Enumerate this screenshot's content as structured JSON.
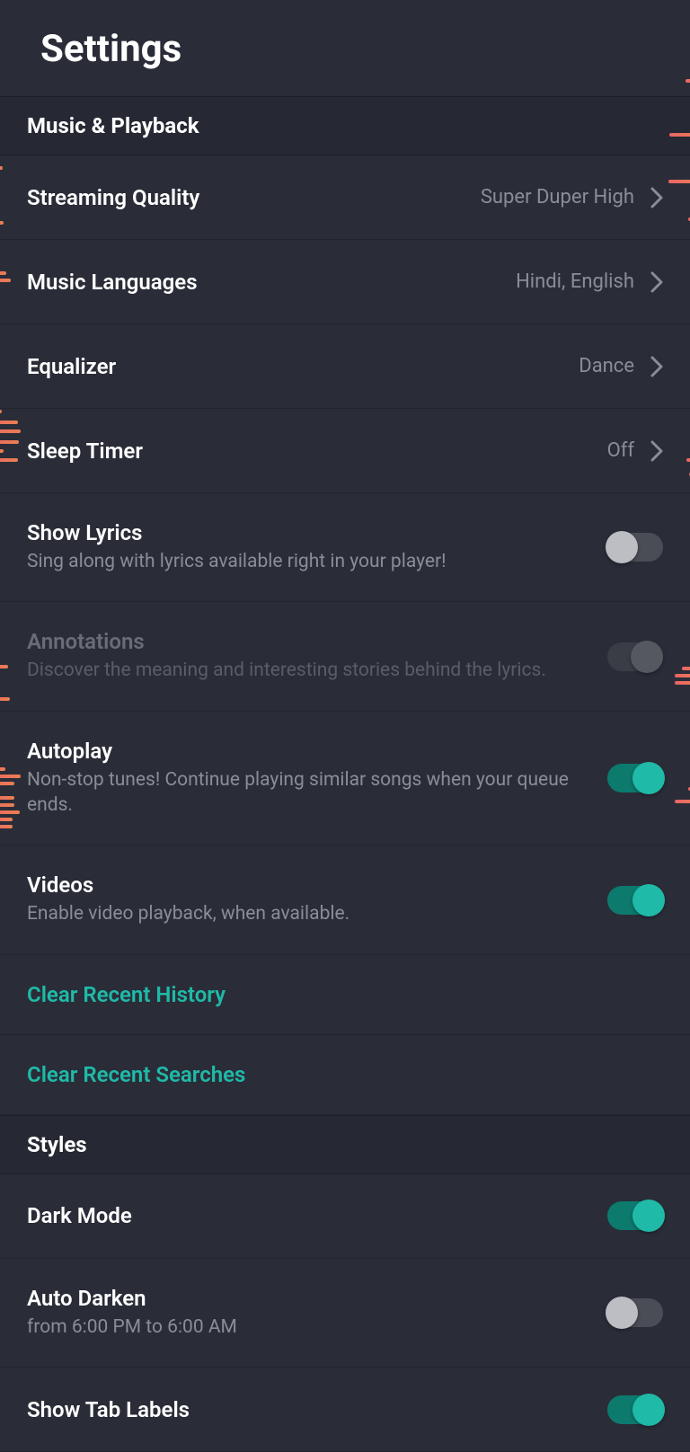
{
  "header": {
    "title": "Settings"
  },
  "sections": {
    "music_playback": {
      "title": "Music & Playback",
      "streaming_quality": {
        "label": "Streaming Quality",
        "value": "Super Duper High"
      },
      "music_languages": {
        "label": "Music Languages",
        "value": "Hindi, English"
      },
      "equalizer": {
        "label": "Equalizer",
        "value": "Dance"
      },
      "sleep_timer": {
        "label": "Sleep Timer",
        "value": "Off"
      },
      "show_lyrics": {
        "label": "Show Lyrics",
        "sublabel": "Sing along with lyrics available right in your player!",
        "enabled": false
      },
      "annotations": {
        "label": "Annotations",
        "sublabel": "Discover the meaning and interesting stories behind the lyrics.",
        "enabled": false,
        "disabled_state": true
      },
      "autoplay": {
        "label": "Autoplay",
        "sublabel": "Non-stop tunes! Continue playing similar songs when your queue ends.",
        "enabled": true
      },
      "videos": {
        "label": "Videos",
        "sublabel": "Enable video playback, when available.",
        "enabled": true
      },
      "clear_history": {
        "label": "Clear Recent History"
      },
      "clear_searches": {
        "label": "Clear Recent Searches"
      }
    },
    "styles": {
      "title": "Styles",
      "dark_mode": {
        "label": "Dark Mode",
        "enabled": true
      },
      "auto_darken": {
        "label": "Auto Darken",
        "sublabel": "from 6:00 PM to 6:00 AM",
        "enabled": false
      },
      "show_tab_labels": {
        "label": "Show Tab Labels",
        "enabled": true
      }
    }
  }
}
